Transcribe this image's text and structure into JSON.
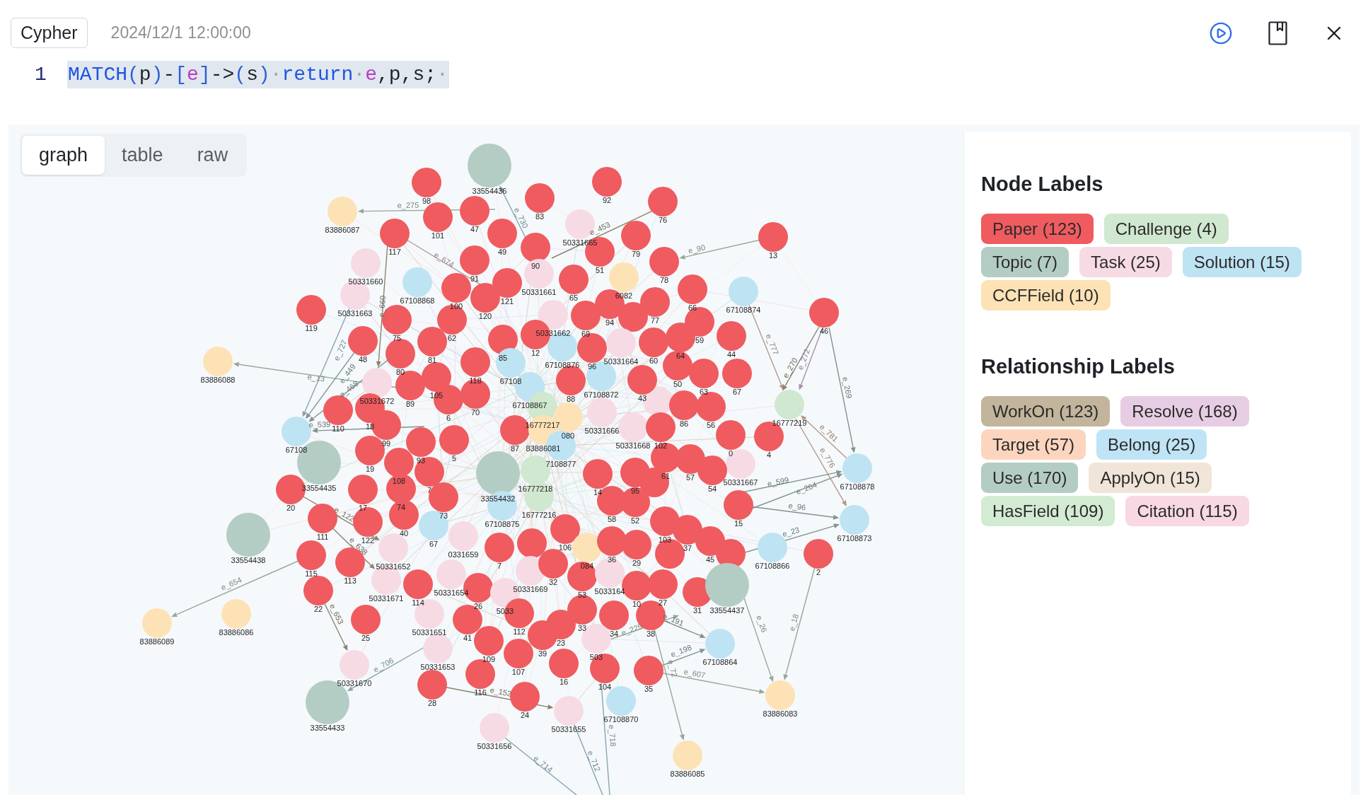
{
  "header": {
    "mode_button": "Cypher",
    "timestamp": "2024/12/1 12:00:00"
  },
  "editor": {
    "line_number": "1",
    "tokens": [
      {
        "text": "MATCH",
        "kind": "keyword"
      },
      {
        "text": "(",
        "kind": "bracket"
      },
      {
        "text": "p",
        "kind": "plain"
      },
      {
        "text": ")",
        "kind": "bracket"
      },
      {
        "text": "-",
        "kind": "plain"
      },
      {
        "text": "[",
        "kind": "bracket"
      },
      {
        "text": "e",
        "kind": "variable"
      },
      {
        "text": "]",
        "kind": "bracket"
      },
      {
        "text": "->",
        "kind": "plain"
      },
      {
        "text": "(",
        "kind": "bracket"
      },
      {
        "text": "s",
        "kind": "plain"
      },
      {
        "text": ")",
        "kind": "bracket"
      },
      {
        "text": "·",
        "kind": "space"
      },
      {
        "text": "return",
        "kind": "keyword"
      },
      {
        "text": "·",
        "kind": "space"
      },
      {
        "text": "e",
        "kind": "variable"
      },
      {
        "text": ",p,s;",
        "kind": "plain"
      },
      {
        "text": "·",
        "kind": "space"
      }
    ]
  },
  "result_tabs": [
    {
      "label": "graph",
      "selected": true
    },
    {
      "label": "table",
      "selected": false
    },
    {
      "label": "raw",
      "selected": false
    }
  ],
  "graph": {
    "nodes": [
      {
        "kind": "paper"
      },
      {
        "kind": "paper"
      },
      {
        "kind": "paper"
      },
      {
        "kind": "paper"
      },
      {
        "kind": "paper"
      },
      {
        "kind": "task"
      },
      {
        "label": "83886087",
        "kind": "ccffield"
      },
      {
        "label": "50331660",
        "kind": "task"
      },
      {
        "label": "50331663",
        "kind": "task"
      },
      {
        "label": "119",
        "kind": "paper"
      },
      {
        "label": "48",
        "kind": "paper"
      },
      {
        "label": "83886088",
        "kind": "ccffield"
      },
      {
        "label": "50331672",
        "kind": "task"
      },
      {
        "label": "110",
        "kind": "paper"
      },
      {
        "label": "67108",
        "kind": "solution"
      },
      {
        "label": "33554435",
        "kind": "topic"
      },
      {
        "label": "117",
        "kind": "paper"
      },
      {
        "label": "75",
        "kind": "paper"
      },
      {
        "label": "18",
        "kind": "paper"
      },
      {
        "label": "99",
        "kind": "paper"
      },
      {
        "label": "19",
        "kind": "paper"
      },
      {
        "label": "33554436",
        "kind": "topic"
      },
      {
        "label": "98",
        "kind": "paper"
      },
      {
        "label": "83",
        "kind": "paper"
      },
      {
        "label": "92",
        "kind": "paper"
      },
      {
        "label": "76",
        "kind": "paper"
      },
      {
        "label": "101",
        "kind": "paper"
      },
      {
        "label": "47",
        "kind": "paper"
      },
      {
        "label": "50331665",
        "kind": "task"
      },
      {
        "label": "49",
        "kind": "paper"
      },
      {
        "label": "79",
        "kind": "paper"
      },
      {
        "label": "13",
        "kind": "paper"
      },
      {
        "label": "90",
        "kind": "paper"
      },
      {
        "label": "50331661",
        "kind": "task"
      },
      {
        "label": "51",
        "kind": "paper"
      },
      {
        "label": "91",
        "kind": "paper"
      },
      {
        "label": "78",
        "kind": "paper"
      },
      {
        "label": "67108868",
        "kind": "solution"
      },
      {
        "label": "65",
        "kind": "paper"
      },
      {
        "label": "6082",
        "kind": "ccffield"
      },
      {
        "label": "100",
        "kind": "paper"
      },
      {
        "label": "121",
        "kind": "paper"
      },
      {
        "label": "120",
        "kind": "paper"
      },
      {
        "label": "66",
        "kind": "paper"
      },
      {
        "label": "67108874",
        "kind": "solution"
      },
      {
        "label": "46",
        "kind": "paper"
      },
      {
        "label": "94",
        "kind": "paper"
      },
      {
        "label": "77",
        "kind": "paper"
      },
      {
        "label": "62",
        "kind": "paper"
      },
      {
        "label": "50331662",
        "kind": "task"
      },
      {
        "label": "69",
        "kind": "paper"
      },
      {
        "label": "81",
        "kind": "paper"
      },
      {
        "label": "85",
        "kind": "paper"
      },
      {
        "label": "12",
        "kind": "paper"
      },
      {
        "label": "59",
        "kind": "paper"
      },
      {
        "label": "60",
        "kind": "paper"
      },
      {
        "label": "64",
        "kind": "paper"
      },
      {
        "label": "44",
        "kind": "paper"
      },
      {
        "label": "67108876",
        "kind": "solution"
      },
      {
        "label": "96",
        "kind": "paper"
      },
      {
        "label": "50331664",
        "kind": "task"
      },
      {
        "label": "80",
        "kind": "paper"
      },
      {
        "label": "118",
        "kind": "paper"
      },
      {
        "label": "67108",
        "kind": "solution"
      },
      {
        "label": "50",
        "kind": "paper"
      },
      {
        "label": "63",
        "kind": "paper"
      },
      {
        "label": "67",
        "kind": "paper"
      },
      {
        "label": "89",
        "kind": "paper"
      },
      {
        "label": "105",
        "kind": "paper"
      },
      {
        "label": "70",
        "kind": "paper"
      },
      {
        "label": "67108867",
        "kind": "solution"
      },
      {
        "label": "88",
        "kind": "paper"
      },
      {
        "label": "67108872",
        "kind": "solution"
      },
      {
        "label": "43",
        "kind": "paper"
      },
      {
        "label": "16777217",
        "kind": "challenge"
      },
      {
        "label": "16777219",
        "kind": "challenge"
      },
      {
        "label": "080",
        "kind": "ccffield"
      },
      {
        "label": "50331666",
        "kind": "task"
      },
      {
        "label": "6",
        "kind": "paper"
      },
      {
        "label": "86",
        "kind": "paper"
      },
      {
        "label": "56",
        "kind": "paper"
      },
      {
        "label": "87",
        "kind": "paper"
      },
      {
        "label": "83886081",
        "kind": "ccffield"
      },
      {
        "label": "50331668",
        "kind": "task"
      },
      {
        "label": "102",
        "kind": "paper"
      },
      {
        "label": "93",
        "kind": "paper"
      },
      {
        "label": "5",
        "kind": "paper"
      },
      {
        "label": "0",
        "kind": "paper"
      },
      {
        "label": "4",
        "kind": "paper"
      },
      {
        "label": "7108877",
        "kind": "solution"
      },
      {
        "label": "50331667",
        "kind": "task"
      },
      {
        "label": "33554432",
        "kind": "topic"
      },
      {
        "label": "16777218",
        "kind": "challenge"
      },
      {
        "label": "16777216",
        "kind": "challenge"
      },
      {
        "label": "67108875",
        "kind": "solution"
      },
      {
        "label": "108",
        "kind": "paper"
      },
      {
        "label": "74",
        "kind": "paper"
      },
      {
        "label": "40",
        "kind": "paper"
      },
      {
        "label": "73",
        "kind": "paper"
      },
      {
        "label": "7",
        "kind": "paper"
      },
      {
        "label": "14",
        "kind": "paper"
      },
      {
        "label": "95",
        "kind": "paper"
      },
      {
        "label": "58",
        "kind": "paper"
      },
      {
        "label": "52",
        "kind": "paper"
      },
      {
        "label": "67",
        "kind": "solution"
      },
      {
        "label": "0331659",
        "kind": "task"
      },
      {
        "label": "111",
        "kind": "paper"
      },
      {
        "label": "122",
        "kind": "paper"
      },
      {
        "label": "20",
        "kind": "paper"
      },
      {
        "label": "17",
        "kind": "paper"
      },
      {
        "label": "33554438",
        "kind": "topic"
      },
      {
        "label": "115",
        "kind": "paper"
      },
      {
        "label": "113",
        "kind": "paper"
      },
      {
        "label": "22",
        "kind": "paper"
      },
      {
        "label": "25",
        "kind": "paper"
      },
      {
        "label": "50331670",
        "kind": "task"
      },
      {
        "label": "33554433",
        "kind": "topic"
      },
      {
        "label": "83886086",
        "kind": "ccffield"
      },
      {
        "label": "83886089",
        "kind": "ccffield"
      },
      {
        "label": "50331652",
        "kind": "task"
      },
      {
        "label": "50331671",
        "kind": "task"
      },
      {
        "label": "114",
        "kind": "paper"
      },
      {
        "label": "50331654",
        "kind": "task"
      },
      {
        "label": "7",
        "kind": "paper"
      },
      {
        "label": "26",
        "kind": "paper"
      },
      {
        "label": "5033",
        "kind": "task"
      },
      {
        "label": "50331669",
        "kind": "task"
      },
      {
        "label": "32",
        "kind": "paper"
      },
      {
        "label": "106",
        "kind": "paper"
      },
      {
        "label": "084",
        "kind": "ccffield"
      },
      {
        "label": "36",
        "kind": "paper"
      },
      {
        "label": "29",
        "kind": "paper"
      },
      {
        "label": "53",
        "kind": "paper"
      },
      {
        "label": "5033164",
        "kind": "task"
      },
      {
        "label": "10",
        "kind": "paper"
      },
      {
        "label": "50331651",
        "kind": "task"
      },
      {
        "label": "41",
        "kind": "paper"
      },
      {
        "label": "112",
        "kind": "paper"
      },
      {
        "label": "50331653",
        "kind": "task"
      },
      {
        "label": "109",
        "kind": "paper"
      },
      {
        "label": "33",
        "kind": "paper"
      },
      {
        "label": "23",
        "kind": "paper"
      },
      {
        "label": "39",
        "kind": "paper"
      },
      {
        "label": "34",
        "kind": "paper"
      },
      {
        "label": "503",
        "kind": "task"
      },
      {
        "label": "107",
        "kind": "paper"
      },
      {
        "label": "116",
        "kind": "paper"
      },
      {
        "label": "16",
        "kind": "paper"
      },
      {
        "label": "104",
        "kind": "paper"
      },
      {
        "label": "28",
        "kind": "paper"
      },
      {
        "label": "24",
        "kind": "paper"
      },
      {
        "label": "50331655",
        "kind": "task"
      },
      {
        "label": "50331656",
        "kind": "task"
      },
      {
        "label": "61",
        "kind": "paper"
      },
      {
        "label": "57",
        "kind": "paper"
      },
      {
        "label": "54",
        "kind": "paper"
      },
      {
        "label": "67108878",
        "kind": "solution"
      },
      {
        "label": "15",
        "kind": "paper"
      },
      {
        "label": "103",
        "kind": "paper"
      },
      {
        "label": "67108873",
        "kind": "solution"
      },
      {
        "label": "37",
        "kind": "paper"
      },
      {
        "label": "45",
        "kind": "paper"
      },
      {
        "label": "67108866",
        "kind": "solution"
      },
      {
        "label": "2",
        "kind": "paper"
      },
      {
        "label": "27",
        "kind": "paper"
      },
      {
        "label": "31",
        "kind": "paper"
      },
      {
        "label": "33554437",
        "kind": "topic"
      },
      {
        "label": "38",
        "kind": "paper"
      },
      {
        "label": "67108864",
        "kind": "solution"
      },
      {
        "label": "35",
        "kind": "paper"
      },
      {
        "label": "67108870",
        "kind": "solution"
      },
      {
        "label": "83886083",
        "kind": "ccffield"
      },
      {
        "label": "83886085",
        "kind": "ccffield"
      }
    ],
    "edges": [
      {
        "label": "e_13",
        "kind": "hasfield"
      },
      {
        "label": "e_654",
        "kind": "hasfield"
      },
      {
        "label": "e_90",
        "kind": "hasfield"
      },
      {
        "label": "e_777",
        "kind": "target"
      },
      {
        "label": "e_272",
        "kind": "resolve"
      },
      {
        "label": "e_270",
        "kind": "workon"
      },
      {
        "label": "e_269",
        "kind": "use"
      },
      {
        "label": "e_781",
        "kind": "target"
      },
      {
        "label": "e_776",
        "kind": "target"
      },
      {
        "label": "e_727",
        "kind": "belong"
      },
      {
        "label": "e_449",
        "kind": "use"
      },
      {
        "label": "e_468",
        "kind": "use"
      },
      {
        "label": "e_539",
        "kind": "use"
      },
      {
        "label": "e_660",
        "kind": "workon"
      },
      {
        "label": "e_275",
        "kind": "hasfield"
      },
      {
        "label": "e_730",
        "kind": "belong"
      },
      {
        "label": "e_674",
        "kind": "citation"
      },
      {
        "label": "e_453",
        "kind": "workon"
      },
      {
        "label": "e_26",
        "kind": "hasfield"
      },
      {
        "label": "e_18",
        "kind": "hasfield"
      },
      {
        "label": "e_198",
        "kind": "use"
      },
      {
        "label": "e_607",
        "kind": "hasfield"
      },
      {
        "label": "e_72",
        "kind": "hasfield"
      },
      {
        "label": "e_191",
        "kind": "use"
      },
      {
        "label": "e_96",
        "kind": "use"
      },
      {
        "label": "e_23",
        "kind": "use"
      },
      {
        "label": "e_264",
        "kind": "use"
      },
      {
        "label": "e_599",
        "kind": "use"
      },
      {
        "label": "e_712",
        "kind": "belong"
      },
      {
        "label": "e_714",
        "kind": "belong"
      },
      {
        "label": "e_718",
        "kind": "belong"
      },
      {
        "label": "e_706",
        "kind": "belong"
      },
      {
        "label": "e_653",
        "kind": "workon"
      },
      {
        "label": "e_638",
        "kind": "workon"
      },
      {
        "label": "e_122",
        "kind": "workon"
      },
      {
        "label": "e_152",
        "kind": "workon"
      },
      {
        "label": "e_225",
        "kind": "hasfield"
      }
    ]
  },
  "legend": {
    "node_title": "Node Labels",
    "node_labels": [
      {
        "text": "Paper (123)",
        "color": "#ef5b5f"
      },
      {
        "text": "Challenge (4)",
        "color": "#cfe8cf"
      },
      {
        "text": "Topic (7)",
        "color": "#b4cdc4"
      },
      {
        "text": "Task (25)",
        "color": "#f7dbe4"
      },
      {
        "text": "Solution (15)",
        "color": "#bee3f3"
      },
      {
        "text": "CCFField (10)",
        "color": "#fde2b5"
      }
    ],
    "relationship_title": "Relationship Labels",
    "relationship_labels": [
      {
        "text": "WorkOn (123)",
        "color": "#c2b59b"
      },
      {
        "text": "Resolve (168)",
        "color": "#e7cde3"
      },
      {
        "text": "Target (57)",
        "color": "#fdd5be"
      },
      {
        "text": "Belong (25)",
        "color": "#bfe4f5"
      },
      {
        "text": "Use (170)",
        "color": "#b4cdc4"
      },
      {
        "text": "ApplyOn (15)",
        "color": "#f1e5d9"
      },
      {
        "text": "HasField (109)",
        "color": "#d2ebd2"
      },
      {
        "text": "Citation (115)",
        "color": "#f8d8e2"
      }
    ]
  }
}
